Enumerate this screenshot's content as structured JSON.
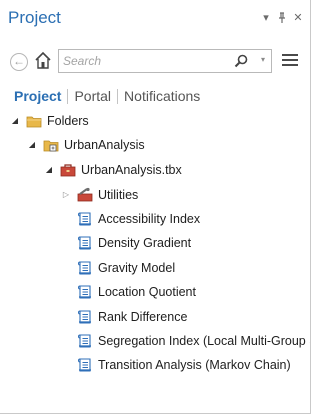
{
  "window": {
    "title": "Project",
    "dropdown_glyph": "▾",
    "pin_glyph": "⊥",
    "close_glyph": "✕"
  },
  "toolbar": {
    "back_glyph": "←",
    "search_placeholder": "Search",
    "search_dropdown_glyph": "▾"
  },
  "tabs": [
    {
      "label": "Project",
      "active": true
    },
    {
      "label": "Portal",
      "active": false
    },
    {
      "label": "Notifications",
      "active": false
    }
  ],
  "tree": {
    "folders": {
      "label": "Folders",
      "expander": "◢"
    },
    "urban_folder": {
      "label": "UrbanAnalysis",
      "expander": "◢"
    },
    "toolbox": {
      "label": "UrbanAnalysis.tbx",
      "expander": "◢"
    },
    "utilities": {
      "label": "Utilities",
      "expander": "▷"
    },
    "tools": [
      "Accessibility Index",
      "Density Gradient",
      "Gravity Model",
      "Location Quotient",
      "Rank Difference",
      "Segregation Index (Local Multi-Group Spatial)",
      "Transition Analysis (Markov Chain)"
    ]
  },
  "colors": {
    "accent": "#2b6fb3",
    "folder": "#e8b84a",
    "toolbox_red": "#b33a2b",
    "script_blue": "#2f6fb8"
  },
  "icons": {
    "back": "back-arrow-icon",
    "home": "home-icon",
    "search": "magnifier-icon",
    "menu": "hamburger-menu-icon",
    "folder": "folder-icon",
    "folder_connection": "folder-connection-icon",
    "toolbox": "toolbox-icon",
    "toolset": "toolset-icon",
    "script_tool": "script-tool-icon"
  }
}
